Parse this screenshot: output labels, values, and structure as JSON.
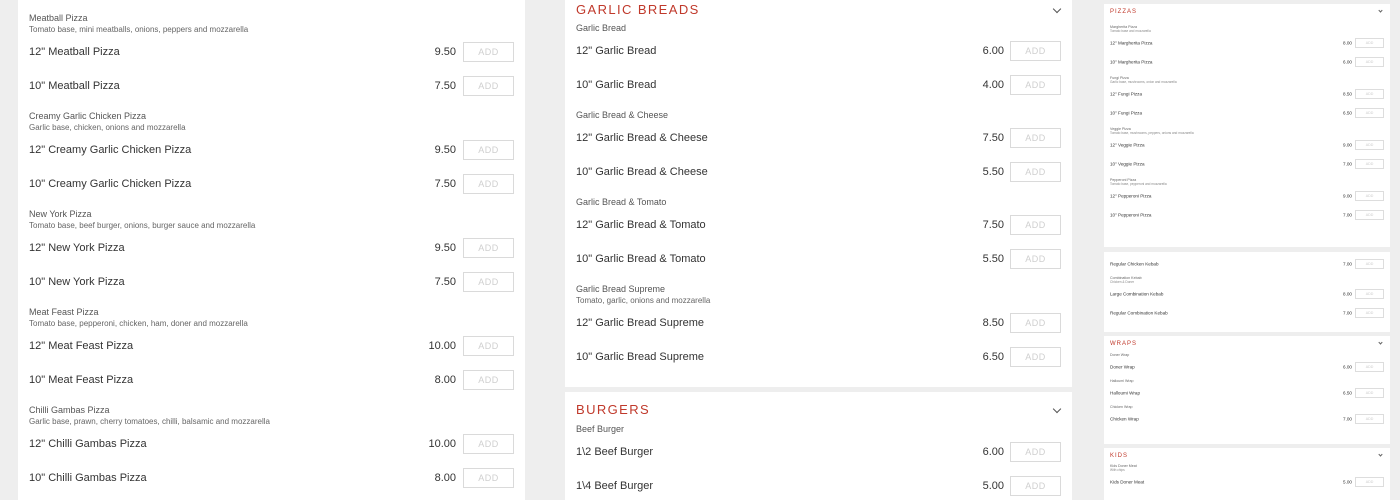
{
  "add_label": "ADD",
  "accent_color": "#c0392b",
  "left": {
    "groups": [
      {
        "name": "Meatball Pizza",
        "desc": "Tomato base, mini meatballs, onions, peppers and mozzarella",
        "items": [
          {
            "name": "12\" Meatball Pizza",
            "price": "9.50"
          },
          {
            "name": "10\" Meatball Pizza",
            "price": "7.50"
          }
        ]
      },
      {
        "name": "Creamy Garlic Chicken Pizza",
        "desc": "Garlic base, chicken, onions and mozzarella",
        "items": [
          {
            "name": "12\" Creamy Garlic Chicken Pizza",
            "price": "9.50"
          },
          {
            "name": "10\" Creamy Garlic Chicken Pizza",
            "price": "7.50"
          }
        ]
      },
      {
        "name": "New York Pizza",
        "desc": "Tomato base, beef burger, onions, burger sauce and mozzarella",
        "items": [
          {
            "name": "12\" New York Pizza",
            "price": "9.50"
          },
          {
            "name": "10\" New York Pizza",
            "price": "7.50"
          }
        ]
      },
      {
        "name": "Meat Feast Pizza",
        "desc": "Tomato base, pepperoni, chicken, ham, doner and mozzarella",
        "items": [
          {
            "name": "12\" Meat Feast Pizza",
            "price": "10.00"
          },
          {
            "name": "10\" Meat Feast Pizza",
            "price": "8.00"
          }
        ]
      },
      {
        "name": "Chilli Gambas Pizza",
        "desc": "Garlic base, prawn, cherry tomatoes, chilli, balsamic and mozzarella",
        "items": [
          {
            "name": "12\" Chilli Gambas Pizza",
            "price": "10.00"
          },
          {
            "name": "10\" Chilli Gambas Pizza",
            "price": "8.00"
          }
        ]
      }
    ]
  },
  "middle": {
    "categories": [
      {
        "title": "GARLIC BREADS",
        "groups": [
          {
            "name": "Garlic Bread",
            "desc": "",
            "items": [
              {
                "name": "12\" Garlic Bread",
                "price": "6.00"
              },
              {
                "name": "10\" Garlic Bread",
                "price": "4.00"
              }
            ]
          },
          {
            "name": "Garlic Bread & Cheese",
            "desc": "",
            "items": [
              {
                "name": "12\" Garlic Bread & Cheese",
                "price": "7.50"
              },
              {
                "name": "10\" Garlic Bread & Cheese",
                "price": "5.50"
              }
            ]
          },
          {
            "name": "Garlic Bread & Tomato",
            "desc": "",
            "items": [
              {
                "name": "12\" Garlic Bread & Tomato",
                "price": "7.50"
              },
              {
                "name": "10\" Garlic Bread & Tomato",
                "price": "5.50"
              }
            ]
          },
          {
            "name": "Garlic Bread Supreme",
            "desc": "Tomato, garlic, onions and mozzarella",
            "items": [
              {
                "name": "12\" Garlic Bread Supreme",
                "price": "8.50"
              },
              {
                "name": "10\" Garlic Bread Supreme",
                "price": "6.50"
              }
            ]
          }
        ]
      },
      {
        "title": "BURGERS",
        "groups": [
          {
            "name": "Beef Burger",
            "desc": "",
            "items": [
              {
                "name": "1\\2 Beef Burger",
                "price": "6.00"
              },
              {
                "name": "1\\4 Beef Burger",
                "price": "5.00"
              }
            ]
          }
        ]
      }
    ]
  },
  "right": {
    "pizzas": {
      "title": "PIZZAS",
      "groups": [
        {
          "name": "Margherita Pizza",
          "desc": "Tomato base and mozzarella",
          "items": [
            {
              "name": "12\" Margherita Pizza",
              "price": "8.00"
            },
            {
              "name": "10\" Margherita Pizza",
              "price": "6.00"
            }
          ]
        },
        {
          "name": "Fungi Pizza",
          "desc": "Garlic base, mushrooms, onion and mozzarella",
          "items": [
            {
              "name": "12\" Fungi Pizza",
              "price": "8.50"
            },
            {
              "name": "10\" Fungi Pizza",
              "price": "6.50"
            }
          ]
        },
        {
          "name": "Veggie Pizza",
          "desc": "Tomato base, mushrooms, peppers, onions and mozzarella",
          "items": [
            {
              "name": "12\" Veggie Pizza",
              "price": "9.00"
            },
            {
              "name": "10\" Veggie Pizza",
              "price": "7.00"
            }
          ]
        },
        {
          "name": "Pepperoni Pizza",
          "desc": "Tomato base, pepperoni and mozzarella",
          "items": [
            {
              "name": "12\" Pepperoni Pizza",
              "price": "9.00"
            },
            {
              "name": "10\" Pepperoni Pizza",
              "price": "7.00"
            }
          ]
        }
      ]
    },
    "kebabs": {
      "groups": [
        {
          "name": "",
          "desc": "",
          "items": [
            {
              "name": "Regular Chicken Kebab",
              "price": "7.00"
            }
          ]
        },
        {
          "name": "Combination Kebab",
          "desc": "Chicken & Doner",
          "items": [
            {
              "name": "Large Combination Kebab",
              "price": "8.00"
            },
            {
              "name": "Regular Combination Kebab",
              "price": "7.00"
            }
          ]
        }
      ]
    },
    "wraps": {
      "title": "WRAPS",
      "groups": [
        {
          "name": "Doner Wrap",
          "desc": "",
          "items": [
            {
              "name": "Doner Wrap",
              "price": "6.00"
            }
          ]
        },
        {
          "name": "Halloumi Wrap",
          "desc": "",
          "items": [
            {
              "name": "Halloumi Wrap",
              "price": "6.50"
            }
          ]
        },
        {
          "name": "Chicken Wrap",
          "desc": "",
          "items": [
            {
              "name": "Chicken Wrap",
              "price": "7.00"
            }
          ]
        }
      ]
    },
    "kids": {
      "title": "KIDS",
      "groups": [
        {
          "name": "Kids Doner Meat",
          "desc": "With chips",
          "items": [
            {
              "name": "Kids Doner Meat",
              "price": "5.00"
            }
          ]
        }
      ]
    }
  }
}
